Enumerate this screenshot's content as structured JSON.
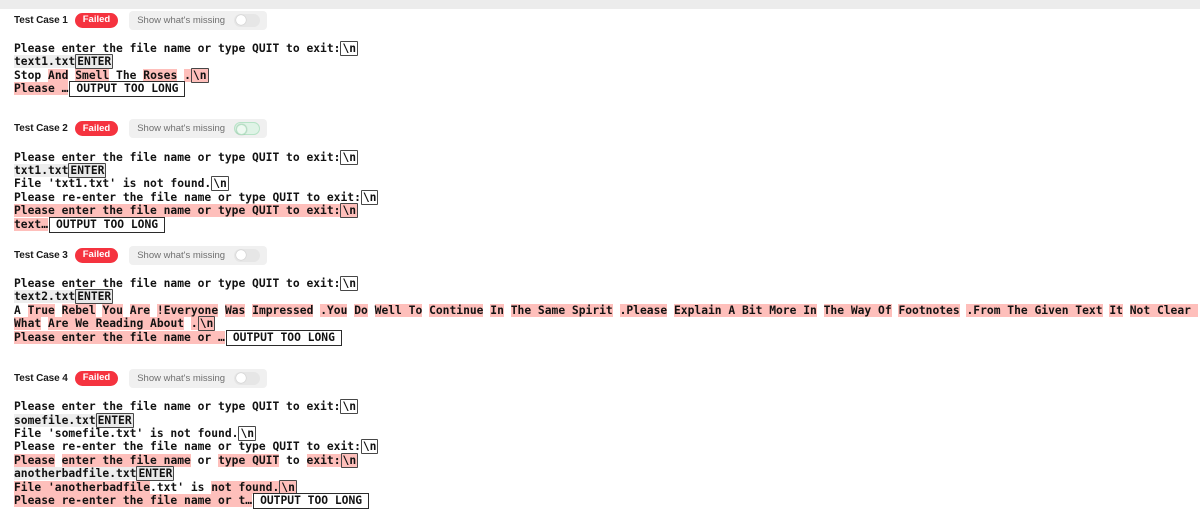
{
  "window": {
    "top_band_color": "#ececec"
  },
  "colors": {
    "fail_badge_bg": "#f5333f",
    "fail_badge_text": "#ffffff",
    "highlight_missing": "#febfbb",
    "input_echo_bg": "#ededed",
    "toggle_on_tint": "#dff3e6"
  },
  "labels": {
    "toggle_label": "Show what's missing",
    "status_failed": "Failed",
    "key_enter": "ENTER",
    "output_too_long": "OUTPUT TOO LONG",
    "newline_token": "\\n"
  },
  "test_cases": [
    {
      "title": "Test Case 1",
      "status": "Failed",
      "toggle_label": "Show what's missing",
      "toggle_on": false,
      "lines": [
        [
          {
            "t": "Please enter the file name or type QUIT to exit:",
            "s": "plain"
          },
          {
            "t": "\\n",
            "s": "esc"
          }
        ],
        [
          {
            "t": "text1.txt",
            "s": "dim"
          },
          {
            "t": "ENTER",
            "s": "key"
          }
        ],
        [
          {
            "t": "Stop ",
            "s": "plain"
          },
          {
            "t": "And",
            "s": "hl"
          },
          {
            "t": " ",
            "s": "plain"
          },
          {
            "t": "Smell",
            "s": "hl"
          },
          {
            "t": " The ",
            "s": "plain"
          },
          {
            "t": "Roses",
            "s": "hl"
          },
          {
            "t": " ",
            "s": "plain"
          },
          {
            "t": ".",
            "s": "hl"
          },
          {
            "t": "\\n",
            "s": "esc-on"
          }
        ],
        [
          {
            "t": "Please ",
            "s": "hl"
          },
          {
            "t": "…",
            "s": "hl"
          },
          {
            "t": "OUTPUT TOO LONG",
            "s": "toolong"
          }
        ]
      ]
    },
    {
      "title": "Test Case 2",
      "status": "Failed",
      "toggle_label": "Show what's missing",
      "toggle_on": true,
      "lines": [
        [
          {
            "t": "Please enter the file name or type QUIT to exit:",
            "s": "plain"
          },
          {
            "t": "\\n",
            "s": "esc"
          }
        ],
        [
          {
            "t": "txt1.txt",
            "s": "dim"
          },
          {
            "t": "ENTER",
            "s": "key"
          }
        ],
        [
          {
            "t": "File 'txt1.txt' is not found.",
            "s": "plain"
          },
          {
            "t": "\\n",
            "s": "esc"
          }
        ],
        [
          {
            "t": "Please re-enter the file name or type QUIT to exit:",
            "s": "plain"
          },
          {
            "t": "\\n",
            "s": "esc"
          }
        ],
        [
          {
            "t": "Please enter the file name or type QUIT to exit:",
            "s": "hl"
          },
          {
            "t": "\\n",
            "s": "esc-on"
          }
        ],
        [
          {
            "t": "text",
            "s": "hl"
          },
          {
            "t": "…",
            "s": "hl"
          },
          {
            "t": "OUTPUT TOO LONG",
            "s": "toolong"
          }
        ]
      ]
    },
    {
      "title": "Test Case 3",
      "status": "Failed",
      "toggle_label": "Show what's missing",
      "toggle_on": false,
      "lines": [
        [
          {
            "t": "Please enter the file name or type QUIT to exit:",
            "s": "plain"
          },
          {
            "t": "\\n",
            "s": "esc"
          }
        ],
        [
          {
            "t": "text2.txt",
            "s": "dim"
          },
          {
            "t": "ENTER",
            "s": "key"
          }
        ],
        [
          {
            "t": "A ",
            "s": "plain"
          },
          {
            "t": "True",
            "s": "hl"
          },
          {
            "t": " ",
            "s": "plain"
          },
          {
            "t": "Rebel",
            "s": "hl"
          },
          {
            "t": " ",
            "s": "plain"
          },
          {
            "t": "You",
            "s": "hl"
          },
          {
            "t": " ",
            "s": "plain"
          },
          {
            "t": "Are",
            "s": "hl"
          },
          {
            "t": " ",
            "s": "plain"
          },
          {
            "t": "!Everyone",
            "s": "hl"
          },
          {
            "t": " ",
            "s": "plain"
          },
          {
            "t": "Was",
            "s": "hl"
          },
          {
            "t": " ",
            "s": "plain"
          },
          {
            "t": "Impressed",
            "s": "hl"
          },
          {
            "t": " ",
            "s": "plain"
          },
          {
            "t": ".You",
            "s": "hl"
          },
          {
            "t": " ",
            "s": "plain"
          },
          {
            "t": "Do",
            "s": "hl"
          },
          {
            "t": " ",
            "s": "plain"
          },
          {
            "t": "Well To",
            "s": "hl"
          },
          {
            "t": " ",
            "s": "plain"
          },
          {
            "t": "Continue",
            "s": "hl"
          },
          {
            "t": " ",
            "s": "plain"
          },
          {
            "t": "In",
            "s": "hl"
          },
          {
            "t": " ",
            "s": "plain"
          },
          {
            "t": "The Same Spirit",
            "s": "hl"
          },
          {
            "t": " ",
            "s": "plain"
          },
          {
            "t": ".Please",
            "s": "hl"
          },
          {
            "t": " ",
            "s": "plain"
          },
          {
            "t": "Explain A Bit More In",
            "s": "hl"
          },
          {
            "t": " ",
            "s": "plain"
          },
          {
            "t": "The Way Of",
            "s": "hl"
          },
          {
            "t": " ",
            "s": "plain"
          },
          {
            "t": "Footnotes",
            "s": "hl"
          },
          {
            "t": " ",
            "s": "plain"
          },
          {
            "t": ".From The Given Text",
            "s": "hl"
          },
          {
            "t": " ",
            "s": "plain"
          },
          {
            "t": "It",
            "s": "hl"
          },
          {
            "t": " ",
            "s": "plain"
          },
          {
            "t": "Not Clear What",
            "s": "hl"
          },
          {
            "t": " ",
            "s": "plain"
          },
          {
            "t": "Are We Reading About",
            "s": "hl"
          },
          {
            "t": " ",
            "s": "plain"
          },
          {
            "t": ".",
            "s": "hl"
          },
          {
            "t": "\\n",
            "s": "esc-on"
          }
        ],
        [
          {
            "t": "Please enter the file name or ",
            "s": "hl"
          },
          {
            "t": "…",
            "s": "hl"
          },
          {
            "t": "OUTPUT TOO LONG",
            "s": "toolong"
          }
        ]
      ]
    },
    {
      "title": "Test Case 4",
      "status": "Failed",
      "toggle_label": "Show what's missing",
      "toggle_on": false,
      "lines": [
        [
          {
            "t": "Please enter the file name or type QUIT to exit:",
            "s": "plain"
          },
          {
            "t": "\\n",
            "s": "esc"
          }
        ],
        [
          {
            "t": "somefile.txt",
            "s": "dim"
          },
          {
            "t": "ENTER",
            "s": "key"
          }
        ],
        [
          {
            "t": "File 'somefile.txt' is not found.",
            "s": "plain"
          },
          {
            "t": "\\n",
            "s": "esc"
          }
        ],
        [
          {
            "t": "Please re-enter the file name or type QUIT to exit:",
            "s": "plain"
          },
          {
            "t": "\\n",
            "s": "esc"
          }
        ],
        [
          {
            "t": "Please",
            "s": "hl"
          },
          {
            "t": " ",
            "s": "plain"
          },
          {
            "t": "enter the file name",
            "s": "hl"
          },
          {
            "t": " or ",
            "s": "plain"
          },
          {
            "t": "type QUIT",
            "s": "hl"
          },
          {
            "t": " to ",
            "s": "plain"
          },
          {
            "t": "exit:",
            "s": "hl"
          },
          {
            "t": "\\n",
            "s": "esc-on"
          }
        ],
        [
          {
            "t": "anotherbadfile.txt",
            "s": "dim"
          },
          {
            "t": "ENTER",
            "s": "key"
          }
        ],
        [
          {
            "t": "File 'anotherbadfile",
            "s": "hl"
          },
          {
            "t": ".txt' is ",
            "s": "plain"
          },
          {
            "t": "not found.",
            "s": "hl"
          },
          {
            "t": "\\n",
            "s": "esc-on"
          }
        ],
        [
          {
            "t": "Please re-enter the file name or t",
            "s": "hl"
          },
          {
            "t": "…",
            "s": "hl"
          },
          {
            "t": "OUTPUT TOO LONG",
            "s": "toolong"
          }
        ]
      ]
    }
  ]
}
